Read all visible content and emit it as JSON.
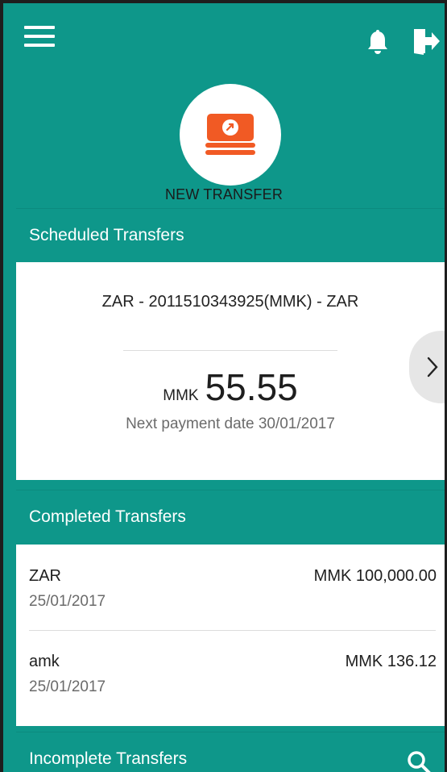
{
  "header": {
    "menu_icon": "hamburger-menu-icon",
    "notification_icon": "bell-icon",
    "logout_icon": "logout-icon"
  },
  "new_transfer": {
    "label": "NEW TRANSFER",
    "icon": "money-transfer-icon",
    "icon_color": "#f15a24"
  },
  "scheduled": {
    "title": "Scheduled Transfers",
    "item": {
      "name": "ZAR - 2011510343925(MMK) - ZAR",
      "currency": "MMK",
      "amount": "55.55",
      "next_payment": "Next payment date 30/01/2017"
    },
    "next_icon": "chevron-right-icon"
  },
  "completed": {
    "title": "Completed Transfers",
    "items": [
      {
        "name": "ZAR",
        "date": "25/01/2017",
        "amount": "MMK 100,000.00"
      },
      {
        "name": "amk",
        "date": "25/01/2017",
        "amount": "MMK 136.12"
      }
    ]
  },
  "incomplete": {
    "title": "Incomplete Transfers",
    "search_icon": "search-icon"
  },
  "colors": {
    "primary": "#0e978a",
    "accent": "#f15a24",
    "text_secondary": "#6b6b6b"
  }
}
